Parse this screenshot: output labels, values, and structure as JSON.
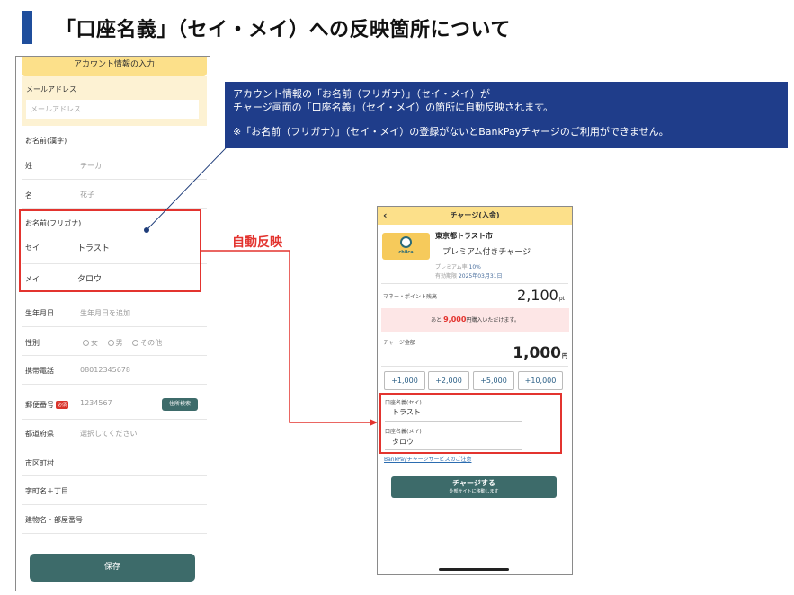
{
  "title": "「口座名義」（セイ・メイ）への反映箇所について",
  "account_form": {
    "header": "アカウント情報の入力",
    "email_label": "メールアドレス",
    "email_placeholder": "メールアドレス",
    "name_kanji_label": "お名前(漢字)",
    "sei_label": "姓",
    "sei_placeholder": "チーカ",
    "mei_label": "名",
    "mei_placeholder": "花子",
    "name_kana_label": "お名前(フリガナ)",
    "kana_sei_label": "セイ",
    "kana_sei_value": "トラスト",
    "kana_mei_label": "メイ",
    "kana_mei_value": "タロウ",
    "birthday_label": "生年月日",
    "birthday_placeholder": "生年月日を追加",
    "gender_label": "性別",
    "gender_options": [
      "女",
      "男",
      "その他"
    ],
    "phone_label": "携帯電話",
    "phone_placeholder": "08012345678",
    "postal_label": "郵便番号",
    "required_badge": "必須",
    "postal_placeholder": "1234567",
    "address_search_button": "住所検索",
    "prefecture_label": "都道府県",
    "prefecture_placeholder": "選択してください",
    "city_label": "市区町村",
    "street_label": "字町名＋丁目",
    "building_label": "建物名・部屋番号",
    "save_button": "保存"
  },
  "callout": {
    "line1": "アカウント情報の「お名前（フリガナ）」（セイ・メイ）が",
    "line2": "チャージ画面の「口座名義」（セイ・メイ）の箇所に自動反映されます。",
    "note": "※「お名前（フリガナ）」（セイ・メイ）の登録がないとBankPayチャージのご利用ができません。"
  },
  "auto_reflect_label": "自動反映",
  "charge_screen": {
    "back_icon": "chevron-left-icon",
    "header": "チャージ(入金)",
    "logo_text": "chiica",
    "city": "東京都トラスト市",
    "product": "プレミアム付きチャージ",
    "premium_rate_label": "プレミアム率",
    "premium_rate_value": "10%",
    "deadline_label": "有効期限",
    "deadline_value": "2025年03月31日",
    "balance_label": "マネー・ポイント残高",
    "balance_value": "2,100",
    "balance_unit": "pt",
    "notice_prefix": "あと",
    "notice_amount": "9,000",
    "notice_suffix": "円購入いただけます。",
    "charge_amount_label": "チャージ金額",
    "charge_amount_value": "1,000",
    "charge_amount_unit": "円",
    "amount_buttons": [
      "+1,000",
      "+2,000",
      "+5,000",
      "+10,000"
    ],
    "account_sei_label": "口座名義(セイ)",
    "account_sei_value": "トラスト",
    "account_mei_label": "口座名義(メイ)",
    "account_mei_value": "タロウ",
    "service_link": "BankPayチャージサービスのご注意",
    "charge_button": "チャージする",
    "charge_button_sub": "外部サイトに移動します"
  },
  "colors": {
    "accent_blue": "#1f3d8a",
    "header_yellow": "#fce08a",
    "button_teal": "#3d6b6a",
    "highlight_red": "#e3342f"
  }
}
